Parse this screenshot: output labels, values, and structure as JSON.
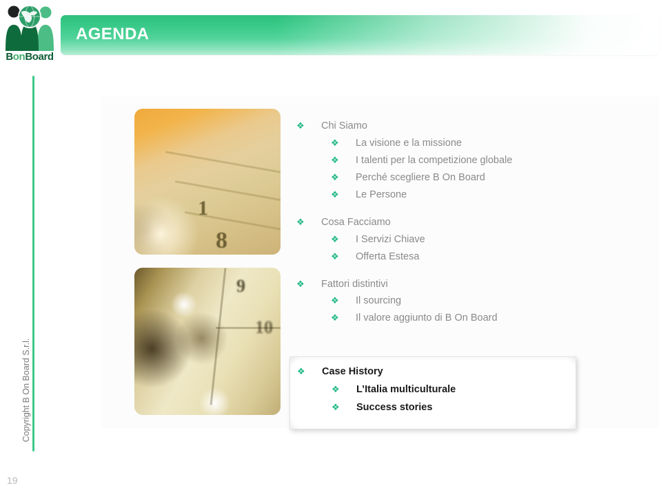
{
  "logo": {
    "icon": "three-people-globe-logo",
    "word_part_1": "B",
    "word_part_2": "on",
    "word_part_3": "Board"
  },
  "header": {
    "title": "AGENDA",
    "banner_color_start": "#2fc07e",
    "banner_color_end": "#ffffff",
    "title_color": "#ffffff"
  },
  "sidebar": {
    "copyright": "Copyright B On Board S.r.l.",
    "page_number": "19",
    "rail_color": "#3ec888"
  },
  "photos": [
    {
      "name": "calendar-planner-photo-top",
      "alt": "Close-up of an open ring-binder agenda showing day numbers",
      "visible_numbers": [
        "1",
        "8"
      ]
    },
    {
      "name": "calendar-planner-photo-bottom",
      "alt": "Blurred close-up of planner rings and day numbers",
      "visible_numbers": [
        "9",
        "10"
      ]
    }
  ],
  "agenda": {
    "bullet_glyph": "❖",
    "bullet_color": "#21b986",
    "text_color": "#8a8a8a",
    "groups": [
      {
        "heading": "Chi Siamo",
        "children": [
          "La visione e la missione",
          "I talenti per la competizione globale",
          "Perché scegliere B On Board",
          "Le Persone"
        ]
      },
      {
        "heading": "Cosa Facciamo",
        "children": [
          "I Servizi Chiave",
          "Offerta Estesa"
        ]
      },
      {
        "heading": "Fattori distintivi",
        "children": [
          "Il sourcing",
          "Il valore aggiunto di B On Board"
        ]
      }
    ]
  },
  "callout": {
    "heading": "Case History",
    "children": [
      "L’Italia multiculturale",
      "Success stories"
    ],
    "text_color": "#1a1a1a"
  }
}
